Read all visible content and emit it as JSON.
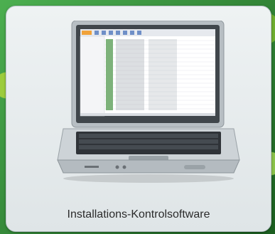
{
  "caption": "Installations-Kontrolsoftware",
  "colors": {
    "card_bg": "#e8edef",
    "background": "#2e7d32",
    "screen_bg": "#ffffff",
    "laptop_body": "#c9cfd3",
    "keyboard": "#2f3338"
  },
  "icons": [
    "laptop-icon"
  ]
}
